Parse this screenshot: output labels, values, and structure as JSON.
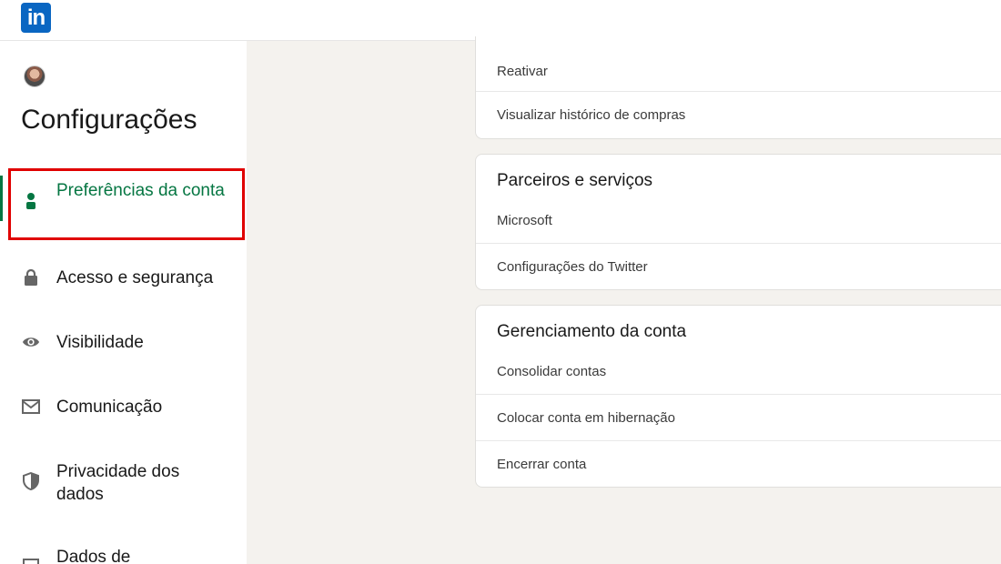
{
  "app": {
    "logo_text": "in",
    "brand_color": "#0a66c2",
    "accent_color": "#057642",
    "highlight_color": "#e00000"
  },
  "sidebar": {
    "title": "Configurações",
    "items": [
      {
        "label": "Preferências da conta",
        "icon": "person-icon",
        "active": true
      },
      {
        "label": "Acesso e segurança",
        "icon": "lock-icon"
      },
      {
        "label": "Visibilidade",
        "icon": "eye-icon"
      },
      {
        "label": "Comunicação",
        "icon": "envelope-icon"
      },
      {
        "label": "Privacidade dos dados",
        "icon": "shield-icon"
      },
      {
        "label": "Dados de",
        "icon": "document-icon"
      }
    ]
  },
  "main": {
    "card1": {
      "rows": [
        "Reativar",
        "Visualizar histórico de compras"
      ]
    },
    "card2": {
      "title": "Parceiros e serviços",
      "rows": [
        "Microsoft",
        "Configurações do Twitter"
      ]
    },
    "card3": {
      "title": "Gerenciamento da conta",
      "rows": [
        "Consolidar contas",
        "Colocar conta em hibernação",
        "Encerrar conta"
      ]
    }
  }
}
